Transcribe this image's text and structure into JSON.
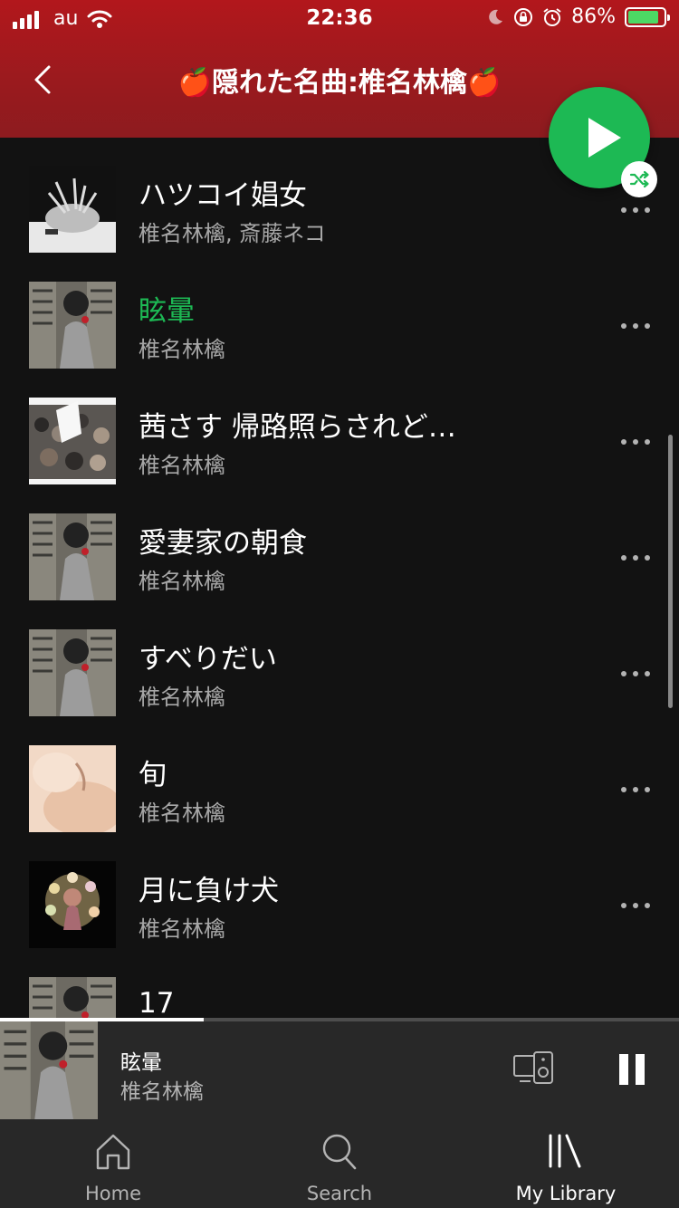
{
  "status_bar": {
    "carrier": "au",
    "time": "22:36",
    "battery": "86%",
    "battery_level": 0.86
  },
  "header": {
    "title": "🍎隠れた名曲:椎名林檎🍎",
    "background": "#a51b1f"
  },
  "tracks": [
    {
      "title": "ハツコイ娼女",
      "artist": "椎名林檎, 斎藤ネコ",
      "playing": false
    },
    {
      "title": "眩暈",
      "artist": "椎名林檎",
      "playing": true
    },
    {
      "title": "茜さす 帰路照らされど…",
      "artist": "椎名林檎",
      "playing": false
    },
    {
      "title": "愛妻家の朝食",
      "artist": "椎名林檎",
      "playing": false
    },
    {
      "title": "すべりだい",
      "artist": "椎名林檎",
      "playing": false
    },
    {
      "title": "旬",
      "artist": "椎名林檎",
      "playing": false
    },
    {
      "title": "月に負け犬",
      "artist": "椎名林檎",
      "playing": false
    },
    {
      "title": "17",
      "artist": "",
      "playing": false
    }
  ],
  "now_playing": {
    "title": "眩暈",
    "artist": "椎名林檎",
    "progress": 0.3
  },
  "tabs": [
    {
      "label": "Home",
      "icon": "home-icon",
      "active": false
    },
    {
      "label": "Search",
      "icon": "search-icon",
      "active": false
    },
    {
      "label": "My Library",
      "icon": "library-icon",
      "active": true
    }
  ],
  "colors": {
    "accent": "#1db954",
    "background": "#121212",
    "player": "#282828"
  }
}
